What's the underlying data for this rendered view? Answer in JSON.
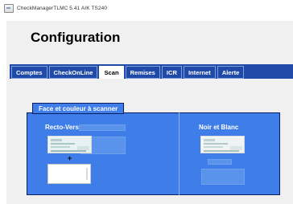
{
  "window": {
    "title": "CheckManagerTLMC 5.41 AIK TS240"
  },
  "page": {
    "title": "Configuration"
  },
  "tabs": [
    {
      "label": "Comptes",
      "active": false
    },
    {
      "label": "CheckOnLine",
      "active": false
    },
    {
      "label": "Scan",
      "active": true
    },
    {
      "label": "Remises",
      "active": false
    },
    {
      "label": "ICR",
      "active": false
    },
    {
      "label": "Internet",
      "active": false
    },
    {
      "label": "Alerte",
      "active": false
    }
  ],
  "scan": {
    "group_label": "Face et couleur à scanner",
    "recto_verso_label": "Recto-Verso",
    "plus_label": "+",
    "noir_blanc_label": "Noir et Blanc"
  },
  "colors": {
    "tab_bar": "#1f4aa8",
    "panel_bg": "#3f7ee8",
    "panel_border": "#0b1d61"
  },
  "icons": [
    "app-window-icon",
    "cheque-image",
    "cheque-image"
  ]
}
